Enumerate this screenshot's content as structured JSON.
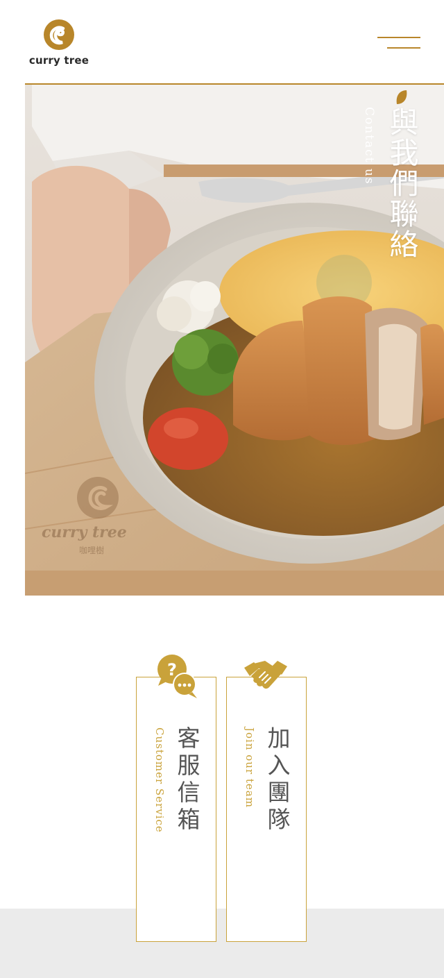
{
  "brand": {
    "name": "curry tree",
    "watermark_name": "curry tree",
    "watermark_sub": "咖哩樹",
    "accent_color": "#b8862a",
    "gold_color": "#c9a23a"
  },
  "header": {
    "menu_icon": "hamburger-menu-icon"
  },
  "hero": {
    "title_zh": "與我們聯絡",
    "title_en": "Contact us",
    "leaf_icon": "leaf-icon"
  },
  "cards": [
    {
      "icon": "chat-question-icon",
      "title_zh": "客服信箱",
      "title_en": "Customer Service"
    },
    {
      "icon": "handshake-icon",
      "title_zh": "加入團隊",
      "title_en": "Join our team"
    }
  ]
}
